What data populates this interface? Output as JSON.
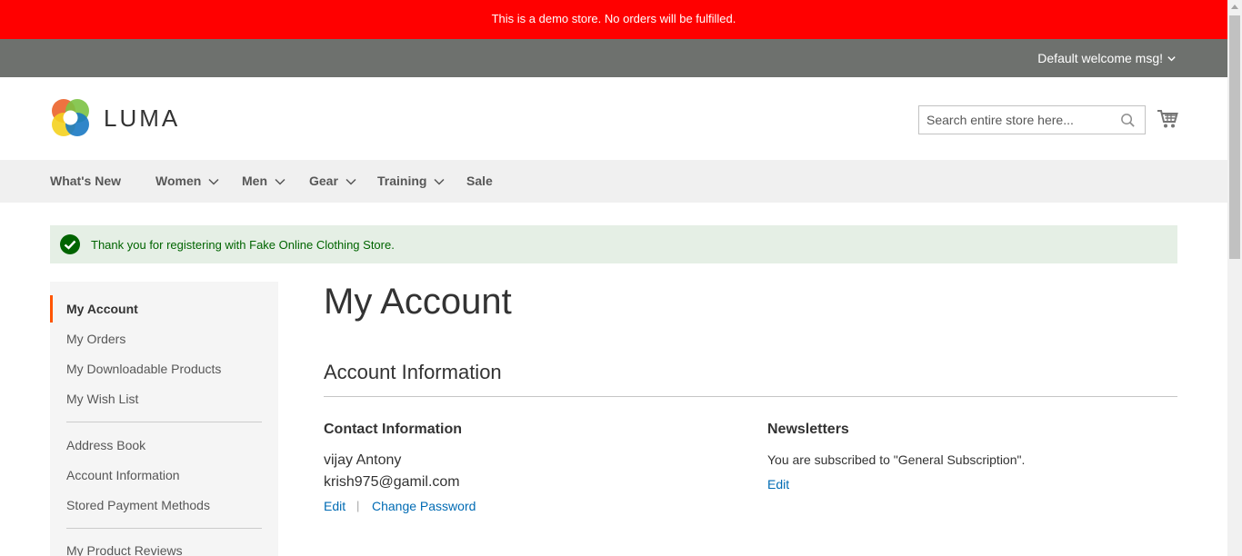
{
  "demo_notice": "This is a demo store. No orders will be fulfilled.",
  "header": {
    "welcome": "Default welcome msg!",
    "logo_text": "LUMA",
    "search_placeholder": "Search entire store here..."
  },
  "nav": [
    {
      "label": "What's New"
    },
    {
      "label": "Women"
    },
    {
      "label": "Men"
    },
    {
      "label": "Gear"
    },
    {
      "label": "Training"
    },
    {
      "label": "Sale"
    }
  ],
  "message": "Thank you for registering with Fake Online Clothing Store.",
  "sidebar": {
    "items": [
      {
        "label": "My Account"
      },
      {
        "label": "My Orders"
      },
      {
        "label": "My Downloadable Products"
      },
      {
        "label": "My Wish List"
      },
      {
        "label": "Address Book"
      },
      {
        "label": "Account Information"
      },
      {
        "label": "Stored Payment Methods"
      },
      {
        "label": "My Product Reviews"
      }
    ]
  },
  "main": {
    "page_title": "My Account",
    "section_title": "Account Information",
    "contact": {
      "title": "Contact Information",
      "name": "vijay Antony",
      "email": "krish975@gamil.com",
      "edit": "Edit",
      "separator": "|",
      "change_password": "Change Password"
    },
    "newsletters": {
      "title": "Newsletters",
      "text": "You are subscribed to \"General Subscription\".",
      "edit": "Edit"
    }
  },
  "colors": {
    "demo_banner": "#ff0000",
    "panel_header": "#6e716e",
    "nav_bg": "#f0f0f0",
    "success_bg": "#e5efe5",
    "success_icon": "#006400",
    "link": "#006bb4",
    "active_bar": "#ff5501"
  },
  "icons": {
    "search": "search-icon",
    "cart": "cart-icon",
    "success": "check-circle-icon",
    "dropdown": "chevron-down-icon"
  }
}
